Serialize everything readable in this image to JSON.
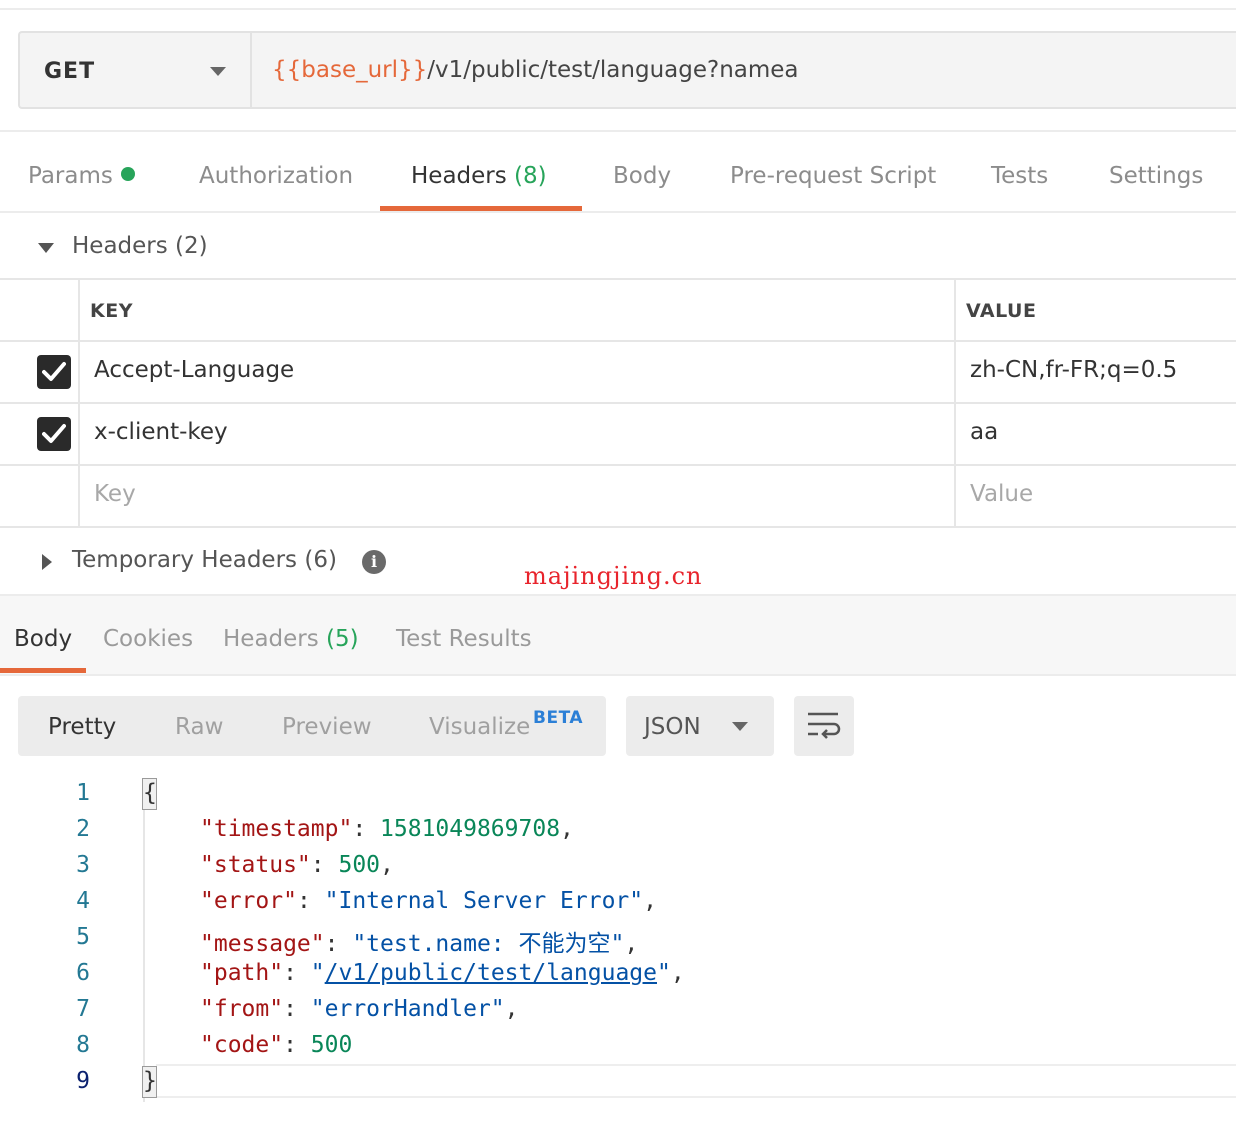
{
  "request": {
    "method": "GET",
    "url_variable": "{{base_url}}",
    "url_path": "/v1/public/test/language?namea"
  },
  "request_tabs": [
    {
      "label": "Params",
      "has_dot": true
    },
    {
      "label": "Authorization"
    },
    {
      "label": "Headers",
      "count": "(8)",
      "active": true
    },
    {
      "label": "Body"
    },
    {
      "label": "Pre-request Script"
    },
    {
      "label": "Tests"
    },
    {
      "label": "Settings"
    }
  ],
  "headers_section": {
    "title": "Headers",
    "count": "(2)",
    "columns": {
      "key": "KEY",
      "value": "VALUE"
    },
    "rows": [
      {
        "checked": true,
        "key": "Accept-Language",
        "value": "zh-CN,fr-FR;q=0.5"
      },
      {
        "checked": true,
        "key": "x-client-key",
        "value": "aa"
      }
    ],
    "placeholder": {
      "key": "Key",
      "value": "Value"
    }
  },
  "temporary_headers": {
    "title": "Temporary Headers",
    "count": "(6)",
    "info_glyph": "i"
  },
  "watermark": "majingjing.cn",
  "response_tabs": [
    {
      "label": "Body",
      "active": true
    },
    {
      "label": "Cookies"
    },
    {
      "label": "Headers",
      "count": "(5)"
    },
    {
      "label": "Test Results"
    }
  ],
  "view_modes": [
    "Pretty",
    "Raw",
    "Preview",
    "Visualize"
  ],
  "beta_badge": "BETA",
  "format": "JSON",
  "response_body": {
    "line_numbers": [
      "1",
      "2",
      "3",
      "4",
      "5",
      "6",
      "7",
      "8",
      "9"
    ],
    "open_brace": "{",
    "close_brace": "}",
    "fields": [
      {
        "key": "\"timestamp\"",
        "value": "1581049869708",
        "type": "number",
        "comma": ","
      },
      {
        "key": "\"status\"",
        "value": "500",
        "type": "number",
        "comma": ","
      },
      {
        "key": "\"error\"",
        "value": "\"Internal Server Error\"",
        "type": "string",
        "comma": ","
      },
      {
        "key": "\"message\"",
        "value": "\"test.name: 不能为空\"",
        "type": "string",
        "comma": ","
      },
      {
        "key": "\"path\"",
        "value": "/v1/public/test/language",
        "type": "link",
        "comma": ","
      },
      {
        "key": "\"from\"",
        "value": "\"errorHandler\"",
        "type": "string",
        "comma": ","
      },
      {
        "key": "\"code\"",
        "value": "500",
        "type": "number",
        "comma": ""
      }
    ]
  },
  "colors": {
    "accent": "#e5683a",
    "success": "#27a45a",
    "beta": "#2b7fd6",
    "watermark": "#e8242c"
  }
}
